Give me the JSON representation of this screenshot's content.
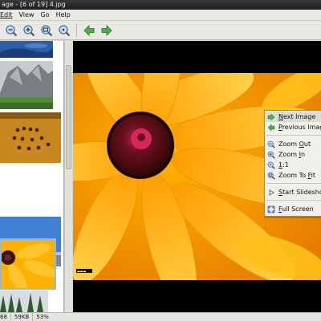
{
  "window": {
    "title": "age - [6 of 19] 4.jpg"
  },
  "menu": {
    "items": [
      "Edit",
      "View",
      "Go",
      "Help"
    ]
  },
  "toolbar": {
    "buttons": [
      "zoom-out-icon",
      "zoom-in-icon",
      "zoom-fit-icon",
      "zoom-1-1-icon",
      "back-arrow-icon",
      "forward-arrow-icon"
    ]
  },
  "context_menu": {
    "items": [
      {
        "pre": "",
        "ul": "N",
        "post": "ext Image",
        "icon": "next-arrow-icon"
      },
      {
        "pre": "",
        "ul": "P",
        "post": "revious Image",
        "icon": "previous-arrow-icon"
      },
      {
        "pre": "Zoom ",
        "ul": "O",
        "post": "ut",
        "icon": "zoom-out-icon"
      },
      {
        "pre": "Zoom ",
        "ul": "I",
        "post": "n",
        "icon": "zoom-in-icon"
      },
      {
        "pre": "",
        "ul": "1",
        "post": ":1",
        "icon": "zoom-1-1-icon"
      },
      {
        "pre": "Zoom To ",
        "ul": "F",
        "post": "it",
        "icon": "zoom-fit-icon"
      },
      {
        "pre": "",
        "ul": "S",
        "post": "tart Slideshow",
        "icon": "play-icon"
      },
      {
        "pre": "",
        "ul": "F",
        "post": "ull Screen",
        "icon": "fullscreen-icon"
      }
    ]
  },
  "statusbar": {
    "dimensions": "68",
    "size": "59KB",
    "zoom": "53%"
  },
  "colors": {
    "accent_green": "#3aa23a",
    "menu_hover": "#dcdcd6",
    "viewer_bg": "#000000",
    "petal": "#ffb000"
  }
}
